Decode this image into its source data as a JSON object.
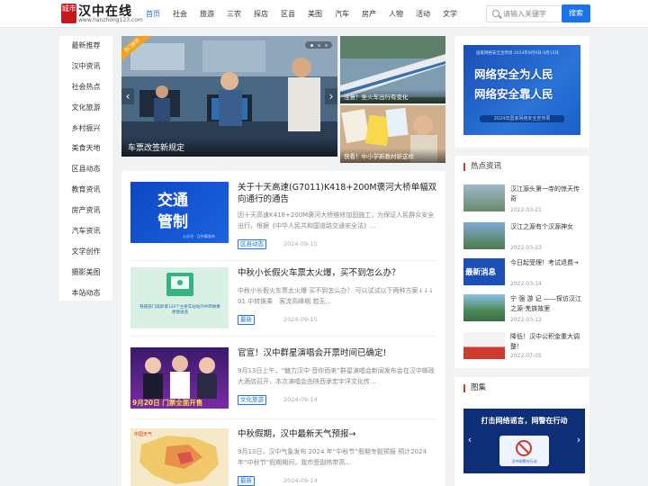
{
  "logo": {
    "badge": "城市",
    "title": "汉中在线",
    "url": "www.hanzhong123.com"
  },
  "nav": [
    "首页",
    "社会",
    "旅游",
    "三农",
    "探店",
    "区县",
    "美图",
    "汽车",
    "房产",
    "人物",
    "活动",
    "文学"
  ],
  "search": {
    "placeholder": "请输入关键字",
    "button": "搜索"
  },
  "sidebar": [
    "最新推荐",
    "汉中资讯",
    "社会热点",
    "文化旅游",
    "乡村振兴",
    "美食天地",
    "区县动态",
    "教育资讯",
    "房产资讯",
    "汽车资讯",
    "文学创作",
    "摄影美图",
    "本站动态"
  ],
  "hero": {
    "main_caption": "车票改签新规定",
    "ribbon": "热门推荐",
    "side1_caption": "注意！坐火车出行有变化",
    "side2_caption": "快看！中小学新教材新这样"
  },
  "articles": [
    {
      "title": "关于十天高速(G7011)K418+200M褒河大桥单幅双向通行的通告",
      "summary": "因十天高速K418+200M褒河大桥维修加固施工，为保证人民群众安全出行，根据《中华人民共和国道路交通安全法》...",
      "tag": "区县动态",
      "date": "2024-09-15",
      "thumb_line1": "交通",
      "thumb_line2": "管制",
      "thumb_note": "公众号 · 汉中事发布"
    },
    {
      "title": "中秋小长假火车票太火爆，买不到怎么办？",
      "summary": "中秋小长假火车票太火爆 买不到怎么办？ 可以试试以下两种方案↓↓↓　01 中转换乘　客流高峰期 若无...",
      "tag": "最新",
      "date": "2024-09-15",
      "thumb_text": "铁路部门辟新增120个主要车站站内中转换乘便捷通道"
    },
    {
      "title": "官宣！汉中群星演唱会开票时间已确定!",
      "summary": "9月13日上午，“魅力汉中·音你而来”群星演唱会新闻发布会在汉中邮政大酒店召开，本次演唱会由陕西承宏宇洋文化传...",
      "tag": "文化旅游",
      "date": "2024-09-14",
      "thumb_text": "9月20日 门票全面开售"
    },
    {
      "title": "中秋假期，汉中最新天气预报→",
      "summary": "9月13日，汉中气象发布 2024 年“中秋节”假期专题预报 预计2024年“中秋节”假期期间，我市受副热带高...",
      "tag": "最新",
      "date": "2024-09-14",
      "thumb_text": "中国天气"
    }
  ],
  "promo": {
    "line1": "网络安全为人民",
    "line2": "网络安全靠人民",
    "sub": "2024年国家网络安全宣传周",
    "top": "国家网络安全宣传周 2024年9月9日-9月15日"
  },
  "hot": {
    "title": "热点资讯",
    "items": [
      {
        "title": "汉江源头第一寺的惊天传奇",
        "date": "2022-03-21"
      },
      {
        "title": "汉江之源有个汉源神女",
        "date": "2022-03-23"
      },
      {
        "title": "今日起受理！考试退费→",
        "date": "2022-03-14",
        "thumb_text": "最新消息"
      },
      {
        "title": "宁 强 游 记 ——探访汉江之源·羌族故里",
        "date": "2022-03-12"
      },
      {
        "title": "降低！汉中公积金重大调整！",
        "date": "2022-07-05"
      }
    ]
  },
  "gallery": {
    "title": "图集",
    "img_line1": "打击网络谣言，网警在行动",
    "img_line2": "汉中网警在行动"
  },
  "colors": {
    "accent": "#1a73e8",
    "brand_red": "#c8161d",
    "section_mark": "#d9342b",
    "ribbon": "#f2a31a"
  }
}
